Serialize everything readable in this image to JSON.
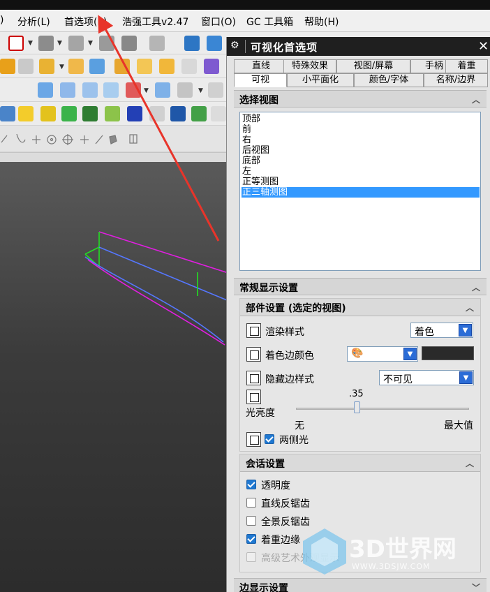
{
  "menu": {
    "items": [
      {
        "label": ")"
      },
      {
        "label": "分析(L)"
      },
      {
        "label": "首选项(P)"
      },
      {
        "label": "浩强工具v2.47"
      },
      {
        "label": "窗口(O)"
      },
      {
        "label": "GC 工具箱"
      },
      {
        "label": "帮助(H)"
      }
    ]
  },
  "dialog": {
    "title": "可视化首选项",
    "tabs_row1": [
      "直线",
      "特殊效果",
      "视图/屏幕",
      "手柄",
      "着重"
    ],
    "tabs_row2": [
      "可视",
      "小平面化",
      "颜色/字体",
      "名称/边界"
    ],
    "active_tab": "可视",
    "select_view": {
      "header": "选择视图",
      "items": [
        "顶部",
        "前",
        "右",
        "后视图",
        "底部",
        "左",
        "正等测图",
        "正三轴测图"
      ],
      "selected": "正三轴测图"
    },
    "general_display": {
      "header": "常规显示设置",
      "part_settings": {
        "header": "部件设置 (选定的视图)",
        "render_style_label": "渲染样式",
        "render_style_value": "着色",
        "shaded_edge_color_label": "着色边颜色",
        "hidden_edge_style_label": "隐藏边样式",
        "hidden_edge_style_value": "不可见",
        "light_brightness_label": "光亮度",
        "light_brightness_value": ".35",
        "light_brightness_fraction": 0.35,
        "slider_min_label": "无",
        "slider_max_label": "最大值",
        "two_sided_light_label": "两侧光",
        "two_sided_light_checked": true
      },
      "session_settings": {
        "header": "会话设置",
        "options": [
          {
            "label": "透明度",
            "checked": true,
            "disabled": false
          },
          {
            "label": "直线反锯齿",
            "checked": false,
            "disabled": false
          },
          {
            "label": "全景反锯齿",
            "checked": false,
            "disabled": false
          },
          {
            "label": "着重边缘",
            "checked": true,
            "disabled": false
          },
          {
            "label": "高级艺术外观显示",
            "checked": false,
            "disabled": true
          }
        ]
      }
    },
    "edge_display": {
      "header": "边显示设置"
    }
  },
  "watermark": {
    "brand": "3D世界网",
    "url": "WWW.3DSJW.COM"
  },
  "colors": {
    "accent": "#3399ff",
    "annotation_arrow": "#e8342a",
    "title_bar": "#1f1f1f"
  }
}
